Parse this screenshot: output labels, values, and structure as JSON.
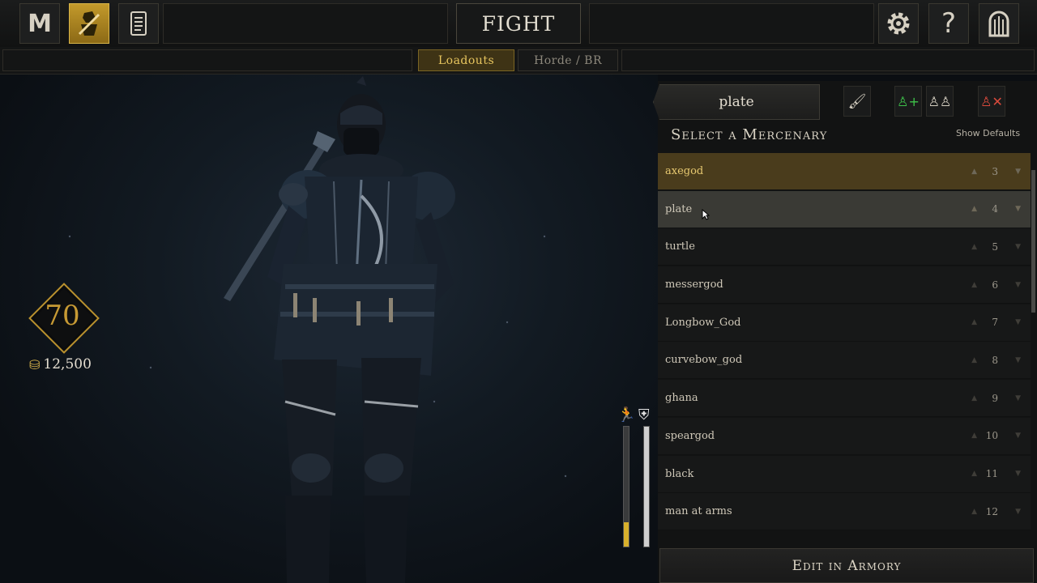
{
  "topbar": {
    "logo_letter": "M",
    "fight_label": "FIGHT",
    "icons": [
      "mordhau-logo-icon",
      "mercenary-icon",
      "scroll-icon",
      "gear-icon",
      "help-icon",
      "exit-door-icon"
    ]
  },
  "subtabs": {
    "loadouts": "Loadouts",
    "horde": "Horde / BR",
    "active": "Loadouts"
  },
  "player": {
    "level": "70",
    "gold": "12,500"
  },
  "stats": {
    "speed_fill": 0.2,
    "armor_fill": 1.0
  },
  "panel": {
    "search_value": "plate",
    "title": "Select a Mercenary",
    "show_defaults": "Show Defaults",
    "edit_label": "Edit in Armory"
  },
  "mercenaries": [
    {
      "name": "axegod",
      "num": "3",
      "state": "selected"
    },
    {
      "name": "plate",
      "num": "4",
      "state": "hover"
    },
    {
      "name": "turtle",
      "num": "5",
      "state": ""
    },
    {
      "name": "messergod",
      "num": "6",
      "state": ""
    },
    {
      "name": "Longbow_God",
      "num": "7",
      "state": ""
    },
    {
      "name": "curvebow_god",
      "num": "8",
      "state": ""
    },
    {
      "name": "ghana",
      "num": "9",
      "state": ""
    },
    {
      "name": "speargod",
      "num": "10",
      "state": ""
    },
    {
      "name": "black",
      "num": "11",
      "state": ""
    },
    {
      "name": "man at arms",
      "num": "12",
      "state": ""
    }
  ],
  "colors": {
    "accent_gold": "#c79a34",
    "selected_row": "#4a3c1c",
    "hover_row": "#3a3a35",
    "panel_bg": "#121313"
  }
}
